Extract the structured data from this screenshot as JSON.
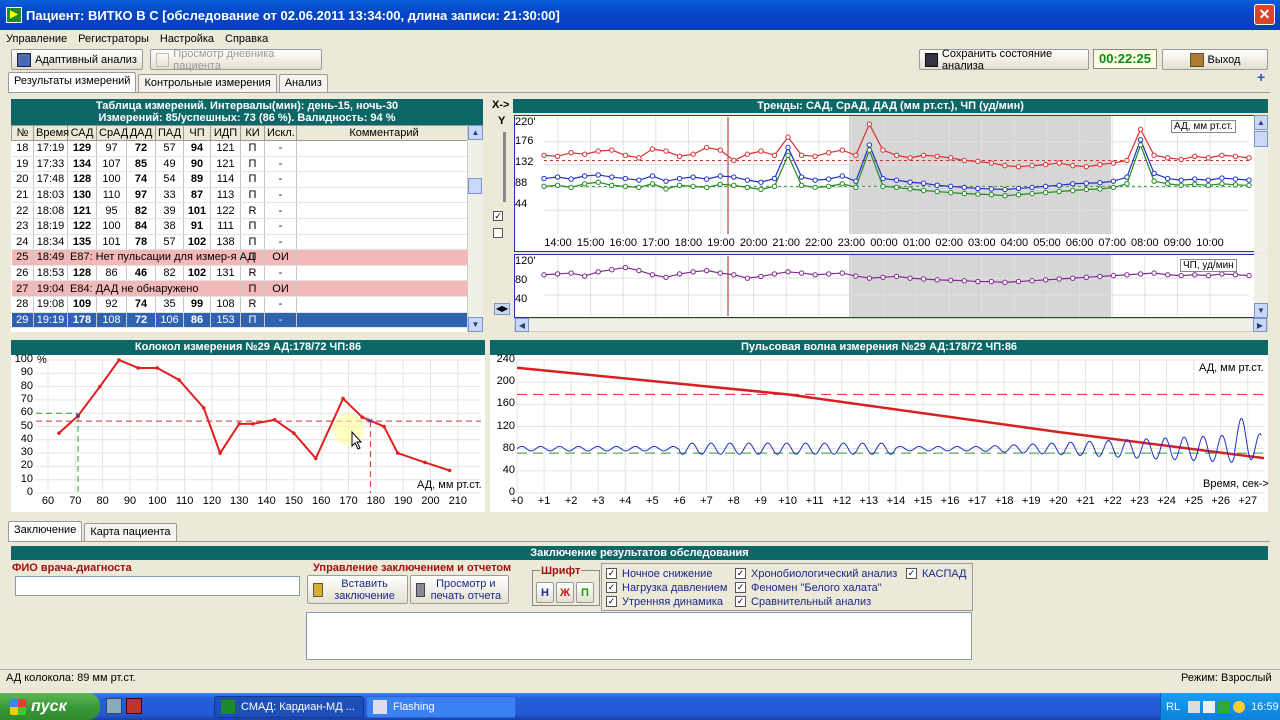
{
  "window": {
    "title": "Пациент: ВИТКО В С [обследование от 02.06.2011 13:34:00, длина записи: 21:30:00]"
  },
  "menu": [
    "Управление",
    "Регистраторы",
    "Настройка",
    "Справка"
  ],
  "toolbar": {
    "adaptive": "Адаптивный анализ",
    "diary": "Просмотр дневника пациента",
    "save_state": "Сохранить состояние анализа",
    "timer": "00:22:25",
    "exit": "Выход"
  },
  "tabs": [
    "Результаты измерений",
    "Контрольные измерения",
    "Анализ"
  ],
  "table": {
    "title_line1": "Таблица измерений. Интервалы(мин): день-15, ночь-30",
    "title_line2": "Измерений: 85/успешных: 73 (86 %). Валидность: 94 %",
    "columns": [
      "№",
      "Время",
      "САД",
      "СрАД",
      "ДАД",
      "ПАД",
      "ЧП",
      "ИДП",
      "КИ",
      "Искл.",
      "Комментарий"
    ],
    "rows": [
      [
        "18",
        "17:19",
        "129",
        "97",
        "72",
        "57",
        "94",
        "121",
        "П",
        "-",
        ""
      ],
      [
        "19",
        "17:33",
        "134",
        "107",
        "85",
        "49",
        "90",
        "121",
        "П",
        "-",
        ""
      ],
      [
        "20",
        "17:48",
        "128",
        "100",
        "74",
        "54",
        "89",
        "114",
        "П",
        "-",
        ""
      ],
      [
        "21",
        "18:03",
        "130",
        "110",
        "97",
        "33",
        "87",
        "113",
        "П",
        "-",
        ""
      ],
      [
        "22",
        "18:08",
        "121",
        "95",
        "82",
        "39",
        "101",
        "122",
        "R",
        "-",
        ""
      ],
      [
        "23",
        "18:19",
        "122",
        "100",
        "84",
        "38",
        "91",
        "111",
        "П",
        "-",
        ""
      ],
      [
        "24",
        "18:34",
        "135",
        "101",
        "78",
        "57",
        "102",
        "138",
        "П",
        "-",
        ""
      ],
      [
        "25",
        "18:49",
        "E87: Нет пульсации для измер-я АД",
        "",
        "",
        "",
        "",
        "",
        "П",
        "ОИ",
        ""
      ],
      [
        "26",
        "18:53",
        "128",
        "86",
        "46",
        "82",
        "102",
        "131",
        "R",
        "-",
        ""
      ],
      [
        "27",
        "19:04",
        "E84: ДАД не обнаружено",
        "",
        "",
        "",
        "",
        "",
        "П",
        "ОИ",
        ""
      ],
      [
        "28",
        "19:08",
        "109",
        "92",
        "74",
        "35",
        "99",
        "108",
        "R",
        "-",
        ""
      ],
      [
        "29",
        "19:19",
        "178",
        "108",
        "72",
        "106",
        "86",
        "153",
        "П",
        "-",
        ""
      ]
    ]
  },
  "trends": {
    "title": "Тренды: САД, СрАД, ДАД (мм рт.ст.), ЧП (уд/мин)",
    "xy_label": "X->",
    "y_label": "Y",
    "bp_label": "АД, мм рт.ст.",
    "hr_label": "ЧП, уд/мин",
    "bp_ticks": [
      "220'",
      "176",
      "132",
      "88",
      "44"
    ],
    "hr_ticks": [
      "120'",
      "80",
      "40"
    ],
    "time_ticks": [
      "14:00",
      "15:00",
      "16:00",
      "17:00",
      "18:00",
      "19:00",
      "20:00",
      "21:00",
      "22:00",
      "23:00",
      "00:00",
      "01:00",
      "02:00",
      "03:00",
      "04:00",
      "05:00",
      "06:00",
      "07:00",
      "08:00",
      "09:00",
      "10:00"
    ],
    "sbp": [
      150,
      148,
      155,
      152,
      158,
      160,
      150,
      145,
      162,
      158,
      148,
      152,
      165,
      160,
      140,
      152,
      158,
      150,
      185,
      150,
      148,
      155,
      160,
      150,
      210,
      160,
      150,
      145,
      150,
      148,
      145,
      140,
      138,
      135,
      130,
      128,
      130,
      132,
      135,
      130,
      128,
      132,
      135,
      140,
      200,
      150,
      145,
      142,
      148,
      145,
      150,
      148,
      145
    ],
    "dbp": [
      90,
      92,
      88,
      95,
      98,
      92,
      90,
      88,
      95,
      85,
      92,
      90,
      88,
      94,
      92,
      88,
      84,
      90,
      150,
      92,
      88,
      90,
      95,
      88,
      160,
      90,
      88,
      85,
      82,
      80,
      78,
      76,
      75,
      74,
      72,
      74,
      76,
      78,
      80,
      82,
      84,
      85,
      88,
      95,
      170,
      100,
      95,
      92,
      94,
      92,
      95,
      93,
      92
    ],
    "mean": [
      105,
      108,
      104,
      110,
      112,
      108,
      105,
      102,
      110,
      100,
      105,
      108,
      104,
      110,
      108,
      102,
      98,
      105,
      165,
      108,
      102,
      104,
      110,
      100,
      170,
      105,
      102,
      98,
      96,
      92,
      90,
      88,
      86,
      85,
      84,
      86,
      88,
      90,
      92,
      95,
      96,
      97,
      100,
      108,
      180,
      115,
      105,
      102,
      104,
      102,
      106,
      104,
      102
    ],
    "hr": [
      88,
      90,
      92,
      85,
      95,
      100,
      105,
      98,
      88,
      82,
      90,
      95,
      98,
      92,
      88,
      80,
      84,
      90,
      95,
      92,
      88,
      90,
      92,
      85,
      80,
      82,
      84,
      80,
      78,
      76,
      75,
      74,
      72,
      72,
      70,
      72,
      74,
      76,
      78,
      80,
      82,
      84,
      86,
      88,
      90,
      92,
      88,
      86,
      88,
      86,
      90,
      88,
      86
    ]
  },
  "bell": {
    "title": "Колокол измерения №29 АД:178/72 ЧП:86",
    "y_unit": "%",
    "x_label": "АД, мм рт.ст.",
    "y_ticks": [
      "100",
      "90",
      "80",
      "70",
      "60",
      "50",
      "40",
      "30",
      "20",
      "10",
      "0"
    ],
    "x_ticks": [
      "60",
      "70",
      "80",
      "90",
      "100",
      "110",
      "120",
      "130",
      "140",
      "150",
      "160",
      "170",
      "180",
      "190",
      "200",
      "210"
    ],
    "points": [
      [
        64,
        45
      ],
      [
        71,
        58
      ],
      [
        79,
        80
      ],
      [
        86,
        100
      ],
      [
        93,
        94
      ],
      [
        100,
        94
      ],
      [
        108,
        85
      ],
      [
        117,
        64
      ],
      [
        123,
        30
      ],
      [
        130,
        52
      ],
      [
        135,
        52
      ],
      [
        143,
        55
      ],
      [
        150,
        45
      ],
      [
        158,
        26
      ],
      [
        168,
        71
      ],
      [
        175,
        57
      ],
      [
        183,
        50
      ],
      [
        188,
        30
      ],
      [
        198,
        23
      ],
      [
        207,
        17
      ]
    ]
  },
  "pulse": {
    "title": "Пульсовая волна измерения №29 АД:178/72 ЧП:86",
    "y_label": "АД, мм рт.ст.",
    "x_label": "Время, сек->",
    "y_ticks": [
      "240",
      "200",
      "160",
      "120",
      "80",
      "40",
      "0"
    ],
    "x_ticks": [
      "+0",
      "+1",
      "+2",
      "+3",
      "+4",
      "+5",
      "+6",
      "+7",
      "+8",
      "+9",
      "+10",
      "+11",
      "+12",
      "+13",
      "+14",
      "+15",
      "+16",
      "+17",
      "+18",
      "+19",
      "+20",
      "+21",
      "+22",
      "+23",
      "+24",
      "+25",
      "+26",
      "+27"
    ]
  },
  "bottom_tabs": [
    "Заключение",
    "Карта пациента"
  ],
  "conclusion": {
    "title": "Заключение результатов обследования",
    "doctor_label": "ФИО врача-диагноста",
    "manage_label": "Управление заключением и отчетом",
    "insert_btn": "Вставить заключение",
    "print_btn": "Просмотр и печать отчета",
    "font_label": "Шрифт",
    "font_buttons": [
      "Н",
      "Ж",
      "П"
    ],
    "checks_col1": [
      "Ночное снижение",
      "Нагрузка давлением",
      "Утренняя динамика"
    ],
    "checks_col2": [
      "Хронобиологический анализ",
      "Феномен \"Белого халата\"",
      "Сравнительный анализ"
    ],
    "checks_col3": [
      "КАСПАД"
    ]
  },
  "status": {
    "left": "АД колокола: 89 мм рт.ст.",
    "right": "Режим: Взрослый"
  },
  "taskbar": {
    "start": "пуск",
    "tasks": [
      "СМАД: Кардиан-МД ...",
      "Flashing"
    ],
    "lang": "RL",
    "clock": "16:59"
  }
}
